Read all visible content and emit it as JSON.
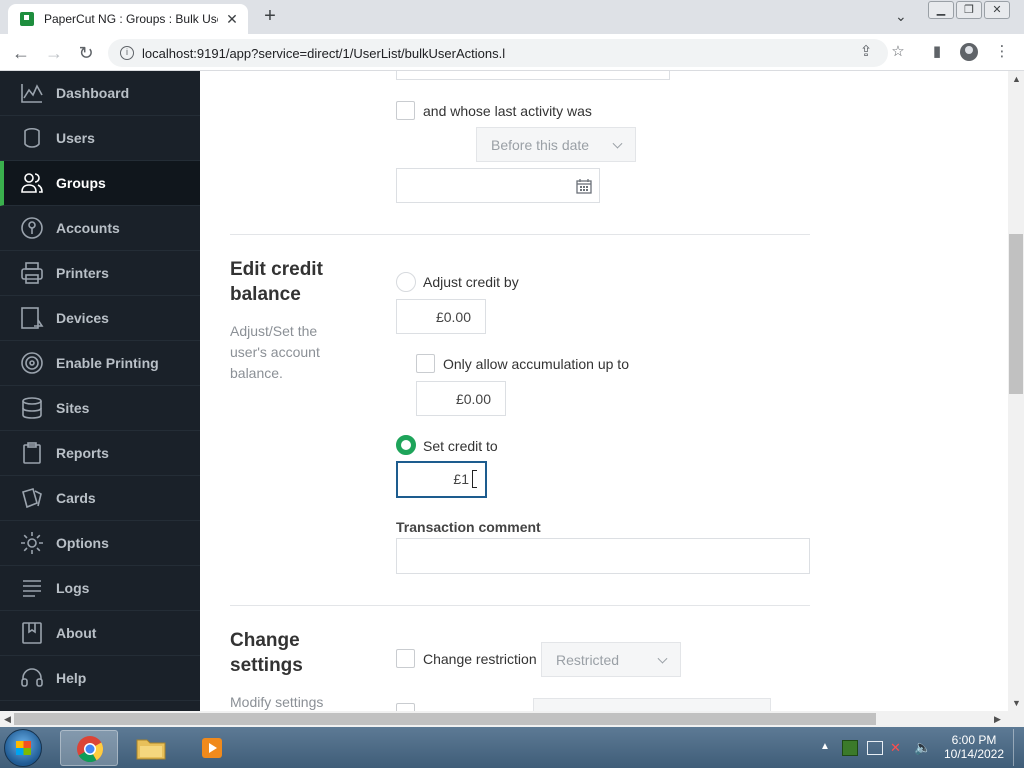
{
  "browser": {
    "tab_title": "PaperCut NG : Groups : Bulk User",
    "url": "localhost:9191/app?service=direct/1/UserList/bulkUserActions.l"
  },
  "sidebar": {
    "items": [
      {
        "label": "Dashboard",
        "icon": "chart-line-icon"
      },
      {
        "label": "Users",
        "icon": "user-icon"
      },
      {
        "label": "Groups",
        "icon": "group-icon"
      },
      {
        "label": "Accounts",
        "icon": "piggy-bank-icon"
      },
      {
        "label": "Printers",
        "icon": "printer-icon"
      },
      {
        "label": "Devices",
        "icon": "device-icon"
      },
      {
        "label": "Enable Printing",
        "icon": "fingerprint-icon"
      },
      {
        "label": "Sites",
        "icon": "database-icon"
      },
      {
        "label": "Reports",
        "icon": "clipboard-icon"
      },
      {
        "label": "Cards",
        "icon": "cards-icon"
      },
      {
        "label": "Options",
        "icon": "gear-icon"
      },
      {
        "label": "Logs",
        "icon": "list-icon"
      },
      {
        "label": "About",
        "icon": "bookmark-icon"
      },
      {
        "label": "Help",
        "icon": "headset-icon"
      }
    ],
    "active": "Groups",
    "accent_color": "#3ab04d"
  },
  "filter": {
    "last_activity_label": "and whose last activity was",
    "date_mode": "Before this date"
  },
  "edit_credit": {
    "title_line1": "Edit credit",
    "title_line2": "balance",
    "desc_line1": "Adjust/Set the",
    "desc_line2": "user's account",
    "desc_line3": "balance.",
    "adjust_label": "Adjust credit by",
    "adjust_value": "£0.00",
    "accumulate_label": "Only allow accumulation up to",
    "accumulate_value": "£0.00",
    "set_label": "Set credit to",
    "set_value": "£1",
    "comment_label": "Transaction comment",
    "comment_value": ""
  },
  "change_settings": {
    "title_line1": "Change",
    "title_line2": "settings",
    "desc_line1": "Modify settings",
    "restriction_label": "Change restriction",
    "restriction_value": "Restricted"
  },
  "taskbar": {
    "time": "6:00 PM",
    "date": "10/14/2022"
  }
}
